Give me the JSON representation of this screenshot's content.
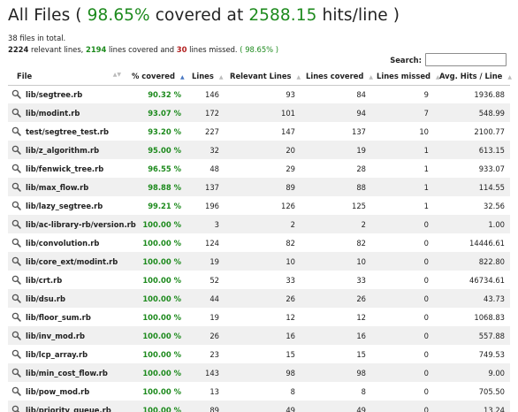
{
  "title": {
    "prefix": "All Files ( ",
    "percent": "98.65%",
    "middle": " covered at ",
    "hits": "2588.15",
    "suffix": " hits/line )"
  },
  "summary": {
    "files_line": "38 files in total.",
    "relevant_lines": "2224",
    "relevant_text": " relevant lines, ",
    "covered_lines": "2194",
    "covered_text": " lines covered",
    "and_text": " and ",
    "missed_lines": "30",
    "missed_text": " lines missed.",
    "percent": " ( 98.65% )"
  },
  "search": {
    "label": "Search:",
    "value": "",
    "placeholder": ""
  },
  "table": {
    "columns": [
      "File",
      "% covered",
      "Lines",
      "Relevant Lines",
      "Lines covered",
      "Lines missed",
      "Avg. Hits / Line"
    ],
    "rows": [
      {
        "file": "lib/segtree.rb",
        "pct": "90.32 %",
        "lines": "146",
        "relevant": "93",
        "covered": "84",
        "missed": "9",
        "avg": "1936.88"
      },
      {
        "file": "lib/modint.rb",
        "pct": "93.07 %",
        "lines": "172",
        "relevant": "101",
        "covered": "94",
        "missed": "7",
        "avg": "548.99"
      },
      {
        "file": "test/segtree_test.rb",
        "pct": "93.20 %",
        "lines": "227",
        "relevant": "147",
        "covered": "137",
        "missed": "10",
        "avg": "2100.77"
      },
      {
        "file": "lib/z_algorithm.rb",
        "pct": "95.00 %",
        "lines": "32",
        "relevant": "20",
        "covered": "19",
        "missed": "1",
        "avg": "613.15"
      },
      {
        "file": "lib/fenwick_tree.rb",
        "pct": "96.55 %",
        "lines": "48",
        "relevant": "29",
        "covered": "28",
        "missed": "1",
        "avg": "933.07"
      },
      {
        "file": "lib/max_flow.rb",
        "pct": "98.88 %",
        "lines": "137",
        "relevant": "89",
        "covered": "88",
        "missed": "1",
        "avg": "114.55"
      },
      {
        "file": "lib/lazy_segtree.rb",
        "pct": "99.21 %",
        "lines": "196",
        "relevant": "126",
        "covered": "125",
        "missed": "1",
        "avg": "32.56"
      },
      {
        "file": "lib/ac-library-rb/version.rb",
        "pct": "100.00 %",
        "lines": "3",
        "relevant": "2",
        "covered": "2",
        "missed": "0",
        "avg": "1.00"
      },
      {
        "file": "lib/convolution.rb",
        "pct": "100.00 %",
        "lines": "124",
        "relevant": "82",
        "covered": "82",
        "missed": "0",
        "avg": "14446.61"
      },
      {
        "file": "lib/core_ext/modint.rb",
        "pct": "100.00 %",
        "lines": "19",
        "relevant": "10",
        "covered": "10",
        "missed": "0",
        "avg": "822.80"
      },
      {
        "file": "lib/crt.rb",
        "pct": "100.00 %",
        "lines": "52",
        "relevant": "33",
        "covered": "33",
        "missed": "0",
        "avg": "46734.61"
      },
      {
        "file": "lib/dsu.rb",
        "pct": "100.00 %",
        "lines": "44",
        "relevant": "26",
        "covered": "26",
        "missed": "0",
        "avg": "43.73"
      },
      {
        "file": "lib/floor_sum.rb",
        "pct": "100.00 %",
        "lines": "19",
        "relevant": "12",
        "covered": "12",
        "missed": "0",
        "avg": "1068.83"
      },
      {
        "file": "lib/inv_mod.rb",
        "pct": "100.00 %",
        "lines": "26",
        "relevant": "16",
        "covered": "16",
        "missed": "0",
        "avg": "557.88"
      },
      {
        "file": "lib/lcp_array.rb",
        "pct": "100.00 %",
        "lines": "23",
        "relevant": "15",
        "covered": "15",
        "missed": "0",
        "avg": "749.53"
      },
      {
        "file": "lib/min_cost_flow.rb",
        "pct": "100.00 %",
        "lines": "143",
        "relevant": "98",
        "covered": "98",
        "missed": "0",
        "avg": "9.00"
      },
      {
        "file": "lib/pow_mod.rb",
        "pct": "100.00 %",
        "lines": "13",
        "relevant": "8",
        "covered": "8",
        "missed": "0",
        "avg": "705.50"
      },
      {
        "file": "lib/priority_queue.rb",
        "pct": "100.00 %",
        "lines": "89",
        "relevant": "49",
        "covered": "49",
        "missed": "0",
        "avg": "13.24"
      }
    ]
  },
  "colors": {
    "covered_green": "#1d8a1d",
    "missed_red": "#b21f1f",
    "row_stripe": "#f0f0f0",
    "sort_active": "#4a78c2"
  },
  "icons": {
    "file_row": "magnifier-icon",
    "sort": "sort-arrows-icon"
  }
}
